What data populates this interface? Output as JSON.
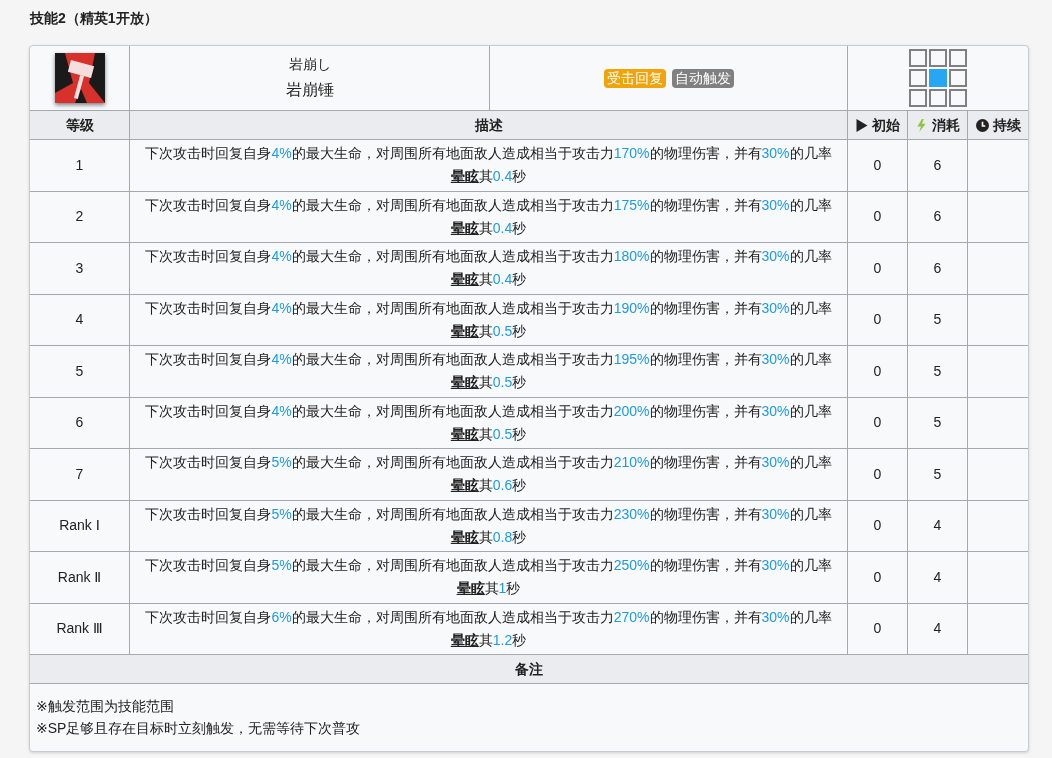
{
  "section_title": "技能2（精英1开放）",
  "skill": {
    "name_jp": "岩崩し",
    "name": "岩崩锤",
    "tags": [
      {
        "text": "受击回复",
        "color": "#f0a30a"
      },
      {
        "text": "自动触发",
        "color": "#808080"
      }
    ],
    "range": [
      [
        {
          "selected": false
        },
        {
          "selected": false
        },
        {
          "selected": false
        }
      ],
      [
        {
          "selected": false
        },
        {
          "selected": true
        },
        {
          "selected": false
        }
      ],
      [
        {
          "selected": false
        },
        {
          "selected": false
        },
        {
          "selected": false
        }
      ]
    ]
  },
  "table": {
    "columns": [
      {
        "label": "等级"
      },
      {
        "label": "描述"
      },
      {
        "label": "初始",
        "kind": "initial"
      },
      {
        "label": "消耗",
        "kind": "cost"
      },
      {
        "label": "持续",
        "kind": "duration"
      }
    ],
    "rows": [
      {
        "level": "1",
        "description": [
          {
            "text": "下次攻击时回复自身",
            "kind": "plain"
          },
          {
            "text": "4%",
            "kind": "value"
          },
          {
            "text": "的最大生命，对周围所有地面敌人造成相当于攻击力",
            "kind": "plain"
          },
          {
            "text": "170%",
            "kind": "value"
          },
          {
            "text": "的物理伤害，并有",
            "kind": "plain"
          },
          {
            "text": "30%",
            "kind": "value"
          },
          {
            "text": "的几率",
            "kind": "plain"
          },
          {
            "text": "晕眩",
            "kind": "term"
          },
          {
            "text": "其",
            "kind": "plain"
          },
          {
            "text": "0.4",
            "kind": "value"
          },
          {
            "text": "秒",
            "kind": "plain"
          }
        ],
        "initial": "0",
        "cost": "6"
      },
      {
        "level": "2",
        "description": [
          {
            "text": "下次攻击时回复自身",
            "kind": "plain"
          },
          {
            "text": "4%",
            "kind": "value"
          },
          {
            "text": "的最大生命，对周围所有地面敌人造成相当于攻击力",
            "kind": "plain"
          },
          {
            "text": "175%",
            "kind": "value"
          },
          {
            "text": "的物理伤害，并有",
            "kind": "plain"
          },
          {
            "text": "30%",
            "kind": "value"
          },
          {
            "text": "的几率",
            "kind": "plain"
          },
          {
            "text": "晕眩",
            "kind": "term"
          },
          {
            "text": "其",
            "kind": "plain"
          },
          {
            "text": "0.4",
            "kind": "value"
          },
          {
            "text": "秒",
            "kind": "plain"
          }
        ],
        "initial": "0",
        "cost": "6"
      },
      {
        "level": "3",
        "description": [
          {
            "text": "下次攻击时回复自身",
            "kind": "plain"
          },
          {
            "text": "4%",
            "kind": "value"
          },
          {
            "text": "的最大生命，对周围所有地面敌人造成相当于攻击力",
            "kind": "plain"
          },
          {
            "text": "180%",
            "kind": "value"
          },
          {
            "text": "的物理伤害，并有",
            "kind": "plain"
          },
          {
            "text": "30%",
            "kind": "value"
          },
          {
            "text": "的几率",
            "kind": "plain"
          },
          {
            "text": "晕眩",
            "kind": "term"
          },
          {
            "text": "其",
            "kind": "plain"
          },
          {
            "text": "0.4",
            "kind": "value"
          },
          {
            "text": "秒",
            "kind": "plain"
          }
        ],
        "initial": "0",
        "cost": "6"
      },
      {
        "level": "4",
        "description": [
          {
            "text": "下次攻击时回复自身",
            "kind": "plain"
          },
          {
            "text": "4%",
            "kind": "value"
          },
          {
            "text": "的最大生命，对周围所有地面敌人造成相当于攻击力",
            "kind": "plain"
          },
          {
            "text": "190%",
            "kind": "value"
          },
          {
            "text": "的物理伤害，并有",
            "kind": "plain"
          },
          {
            "text": "30%",
            "kind": "value"
          },
          {
            "text": "的几率",
            "kind": "plain"
          },
          {
            "text": "晕眩",
            "kind": "term"
          },
          {
            "text": "其",
            "kind": "plain"
          },
          {
            "text": "0.5",
            "kind": "value"
          },
          {
            "text": "秒",
            "kind": "plain"
          }
        ],
        "initial": "0",
        "cost": "5"
      },
      {
        "level": "5",
        "description": [
          {
            "text": "下次攻击时回复自身",
            "kind": "plain"
          },
          {
            "text": "4%",
            "kind": "value"
          },
          {
            "text": "的最大生命，对周围所有地面敌人造成相当于攻击力",
            "kind": "plain"
          },
          {
            "text": "195%",
            "kind": "value"
          },
          {
            "text": "的物理伤害，并有",
            "kind": "plain"
          },
          {
            "text": "30%",
            "kind": "value"
          },
          {
            "text": "的几率",
            "kind": "plain"
          },
          {
            "text": "晕眩",
            "kind": "term"
          },
          {
            "text": "其",
            "kind": "plain"
          },
          {
            "text": "0.5",
            "kind": "value"
          },
          {
            "text": "秒",
            "kind": "plain"
          }
        ],
        "initial": "0",
        "cost": "5"
      },
      {
        "level": "6",
        "description": [
          {
            "text": "下次攻击时回复自身",
            "kind": "plain"
          },
          {
            "text": "4%",
            "kind": "value"
          },
          {
            "text": "的最大生命，对周围所有地面敌人造成相当于攻击力",
            "kind": "plain"
          },
          {
            "text": "200%",
            "kind": "value"
          },
          {
            "text": "的物理伤害，并有",
            "kind": "plain"
          },
          {
            "text": "30%",
            "kind": "value"
          },
          {
            "text": "的几率",
            "kind": "plain"
          },
          {
            "text": "晕眩",
            "kind": "term"
          },
          {
            "text": "其",
            "kind": "plain"
          },
          {
            "text": "0.5",
            "kind": "value"
          },
          {
            "text": "秒",
            "kind": "plain"
          }
        ],
        "initial": "0",
        "cost": "5"
      },
      {
        "level": "7",
        "description": [
          {
            "text": "下次攻击时回复自身",
            "kind": "plain"
          },
          {
            "text": "5%",
            "kind": "value"
          },
          {
            "text": "的最大生命，对周围所有地面敌人造成相当于攻击力",
            "kind": "plain"
          },
          {
            "text": "210%",
            "kind": "value"
          },
          {
            "text": "的物理伤害，并有",
            "kind": "plain"
          },
          {
            "text": "30%",
            "kind": "value"
          },
          {
            "text": "的几率",
            "kind": "plain"
          },
          {
            "text": "晕眩",
            "kind": "term"
          },
          {
            "text": "其",
            "kind": "plain"
          },
          {
            "text": "0.6",
            "kind": "value"
          },
          {
            "text": "秒",
            "kind": "plain"
          }
        ],
        "initial": "0",
        "cost": "5"
      },
      {
        "level": "Rank Ⅰ",
        "description": [
          {
            "text": "下次攻击时回复自身",
            "kind": "plain"
          },
          {
            "text": "5%",
            "kind": "value"
          },
          {
            "text": "的最大生命，对周围所有地面敌人造成相当于攻击力",
            "kind": "plain"
          },
          {
            "text": "230%",
            "kind": "value"
          },
          {
            "text": "的物理伤害，并有",
            "kind": "plain"
          },
          {
            "text": "30%",
            "kind": "value"
          },
          {
            "text": "的几率",
            "kind": "plain"
          },
          {
            "text": "晕眩",
            "kind": "term"
          },
          {
            "text": "其",
            "kind": "plain"
          },
          {
            "text": "0.8",
            "kind": "value"
          },
          {
            "text": "秒",
            "kind": "plain"
          }
        ],
        "initial": "0",
        "cost": "4"
      },
      {
        "level": "Rank Ⅱ",
        "description": [
          {
            "text": "下次攻击时回复自身",
            "kind": "plain"
          },
          {
            "text": "5%",
            "kind": "value"
          },
          {
            "text": "的最大生命，对周围所有地面敌人造成相当于攻击力",
            "kind": "plain"
          },
          {
            "text": "250%",
            "kind": "value"
          },
          {
            "text": "的物理伤害，并有",
            "kind": "plain"
          },
          {
            "text": "30%",
            "kind": "value"
          },
          {
            "text": "的几率",
            "kind": "plain"
          },
          {
            "text": "晕眩",
            "kind": "term"
          },
          {
            "text": "其",
            "kind": "plain"
          },
          {
            "text": "1",
            "kind": "value"
          },
          {
            "text": "秒",
            "kind": "plain"
          }
        ],
        "initial": "0",
        "cost": "4"
      },
      {
        "level": "Rank Ⅲ",
        "description": [
          {
            "text": "下次攻击时回复自身",
            "kind": "plain"
          },
          {
            "text": "6%",
            "kind": "value"
          },
          {
            "text": "的最大生命，对周围所有地面敌人造成相当于攻击力",
            "kind": "plain"
          },
          {
            "text": "270%",
            "kind": "value"
          },
          {
            "text": "的物理伤害，并有",
            "kind": "plain"
          },
          {
            "text": "30%",
            "kind": "value"
          },
          {
            "text": "的几率",
            "kind": "plain"
          },
          {
            "text": "晕眩",
            "kind": "term"
          },
          {
            "text": "其",
            "kind": "plain"
          },
          {
            "text": "1.2",
            "kind": "value"
          },
          {
            "text": "秒",
            "kind": "plain"
          }
        ],
        "initial": "0",
        "cost": "4"
      }
    ]
  },
  "notes": {
    "heading": "备注",
    "lines": [
      "※触发范围为技能范围",
      "※SP足够且存在目标时立刻触发，无需等待下次普攻"
    ]
  }
}
